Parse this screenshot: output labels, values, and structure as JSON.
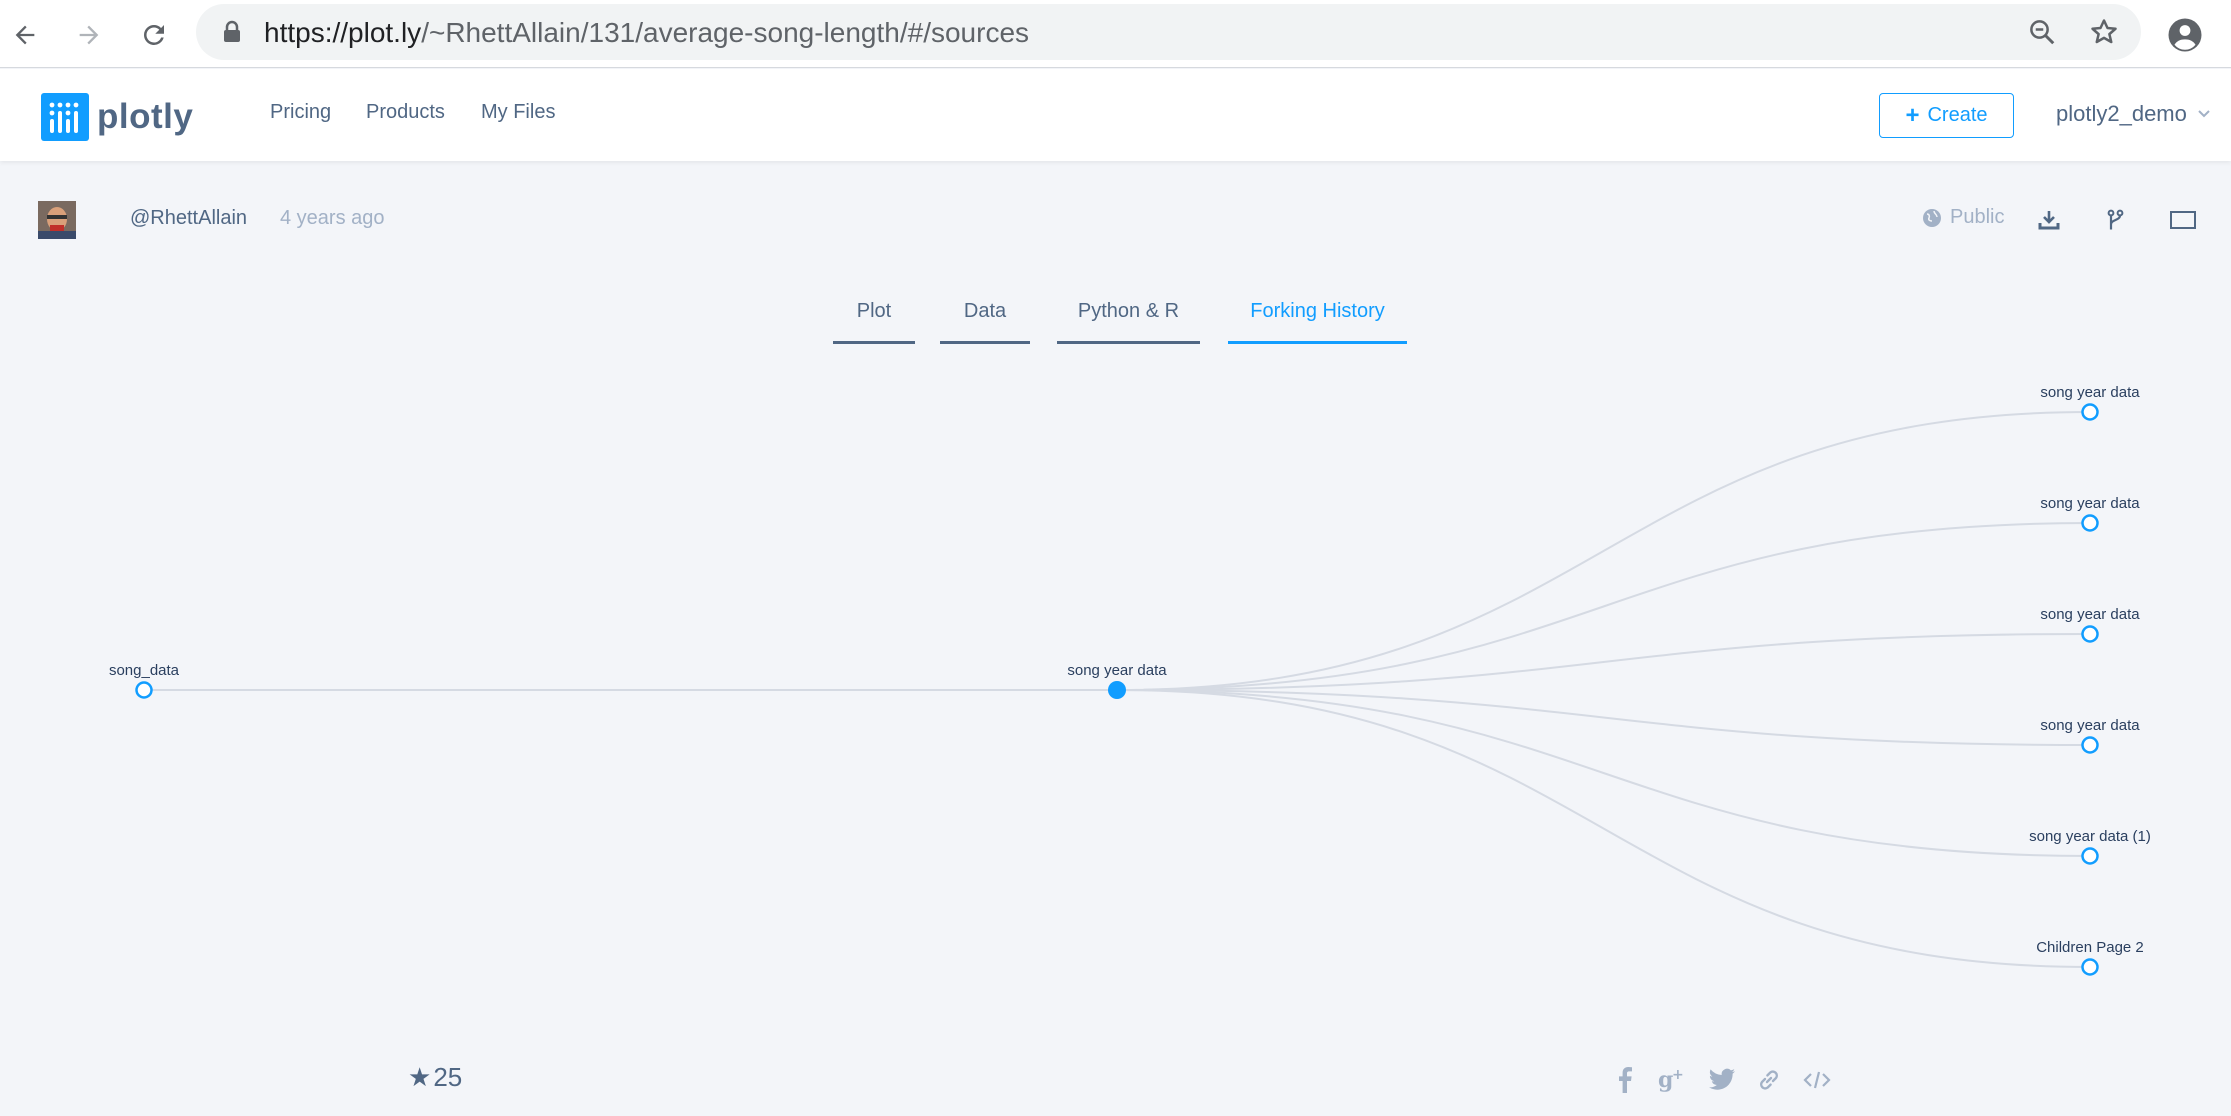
{
  "browser": {
    "url_host": "https://plot.ly",
    "url_path": "/~RhettAllain/131/average-song-length/#/sources"
  },
  "header": {
    "logo_text": "plotly",
    "nav": [
      "Pricing",
      "Products",
      "My Files"
    ],
    "create_label": "Create",
    "username": "plotly2_demo"
  },
  "meta": {
    "author": "@RhettAllain",
    "time": "4 years ago",
    "visibility": "Public"
  },
  "tabs": [
    {
      "label": "Plot",
      "active": false
    },
    {
      "label": "Data",
      "active": false
    },
    {
      "label": "Python & R",
      "active": false
    },
    {
      "label": "Forking History",
      "active": true
    }
  ],
  "tree": {
    "root": {
      "label": "song_data"
    },
    "current": {
      "label": "song year data"
    },
    "children": [
      {
        "label": "song year data"
      },
      {
        "label": "song year data"
      },
      {
        "label": "song year data"
      },
      {
        "label": "song year data"
      },
      {
        "label": "song year data (1)"
      },
      {
        "label": "Children Page 2"
      }
    ]
  },
  "footer": {
    "star_count": "25",
    "share_icons": [
      "facebook-icon",
      "google-plus-icon",
      "twitter-icon",
      "link-icon",
      "embed-code-icon"
    ]
  },
  "colors": {
    "accent": "#119dff",
    "text": "#506784",
    "muted": "#a2b1c6",
    "edge": "#d5dae3",
    "background": "#f3f5f9"
  }
}
